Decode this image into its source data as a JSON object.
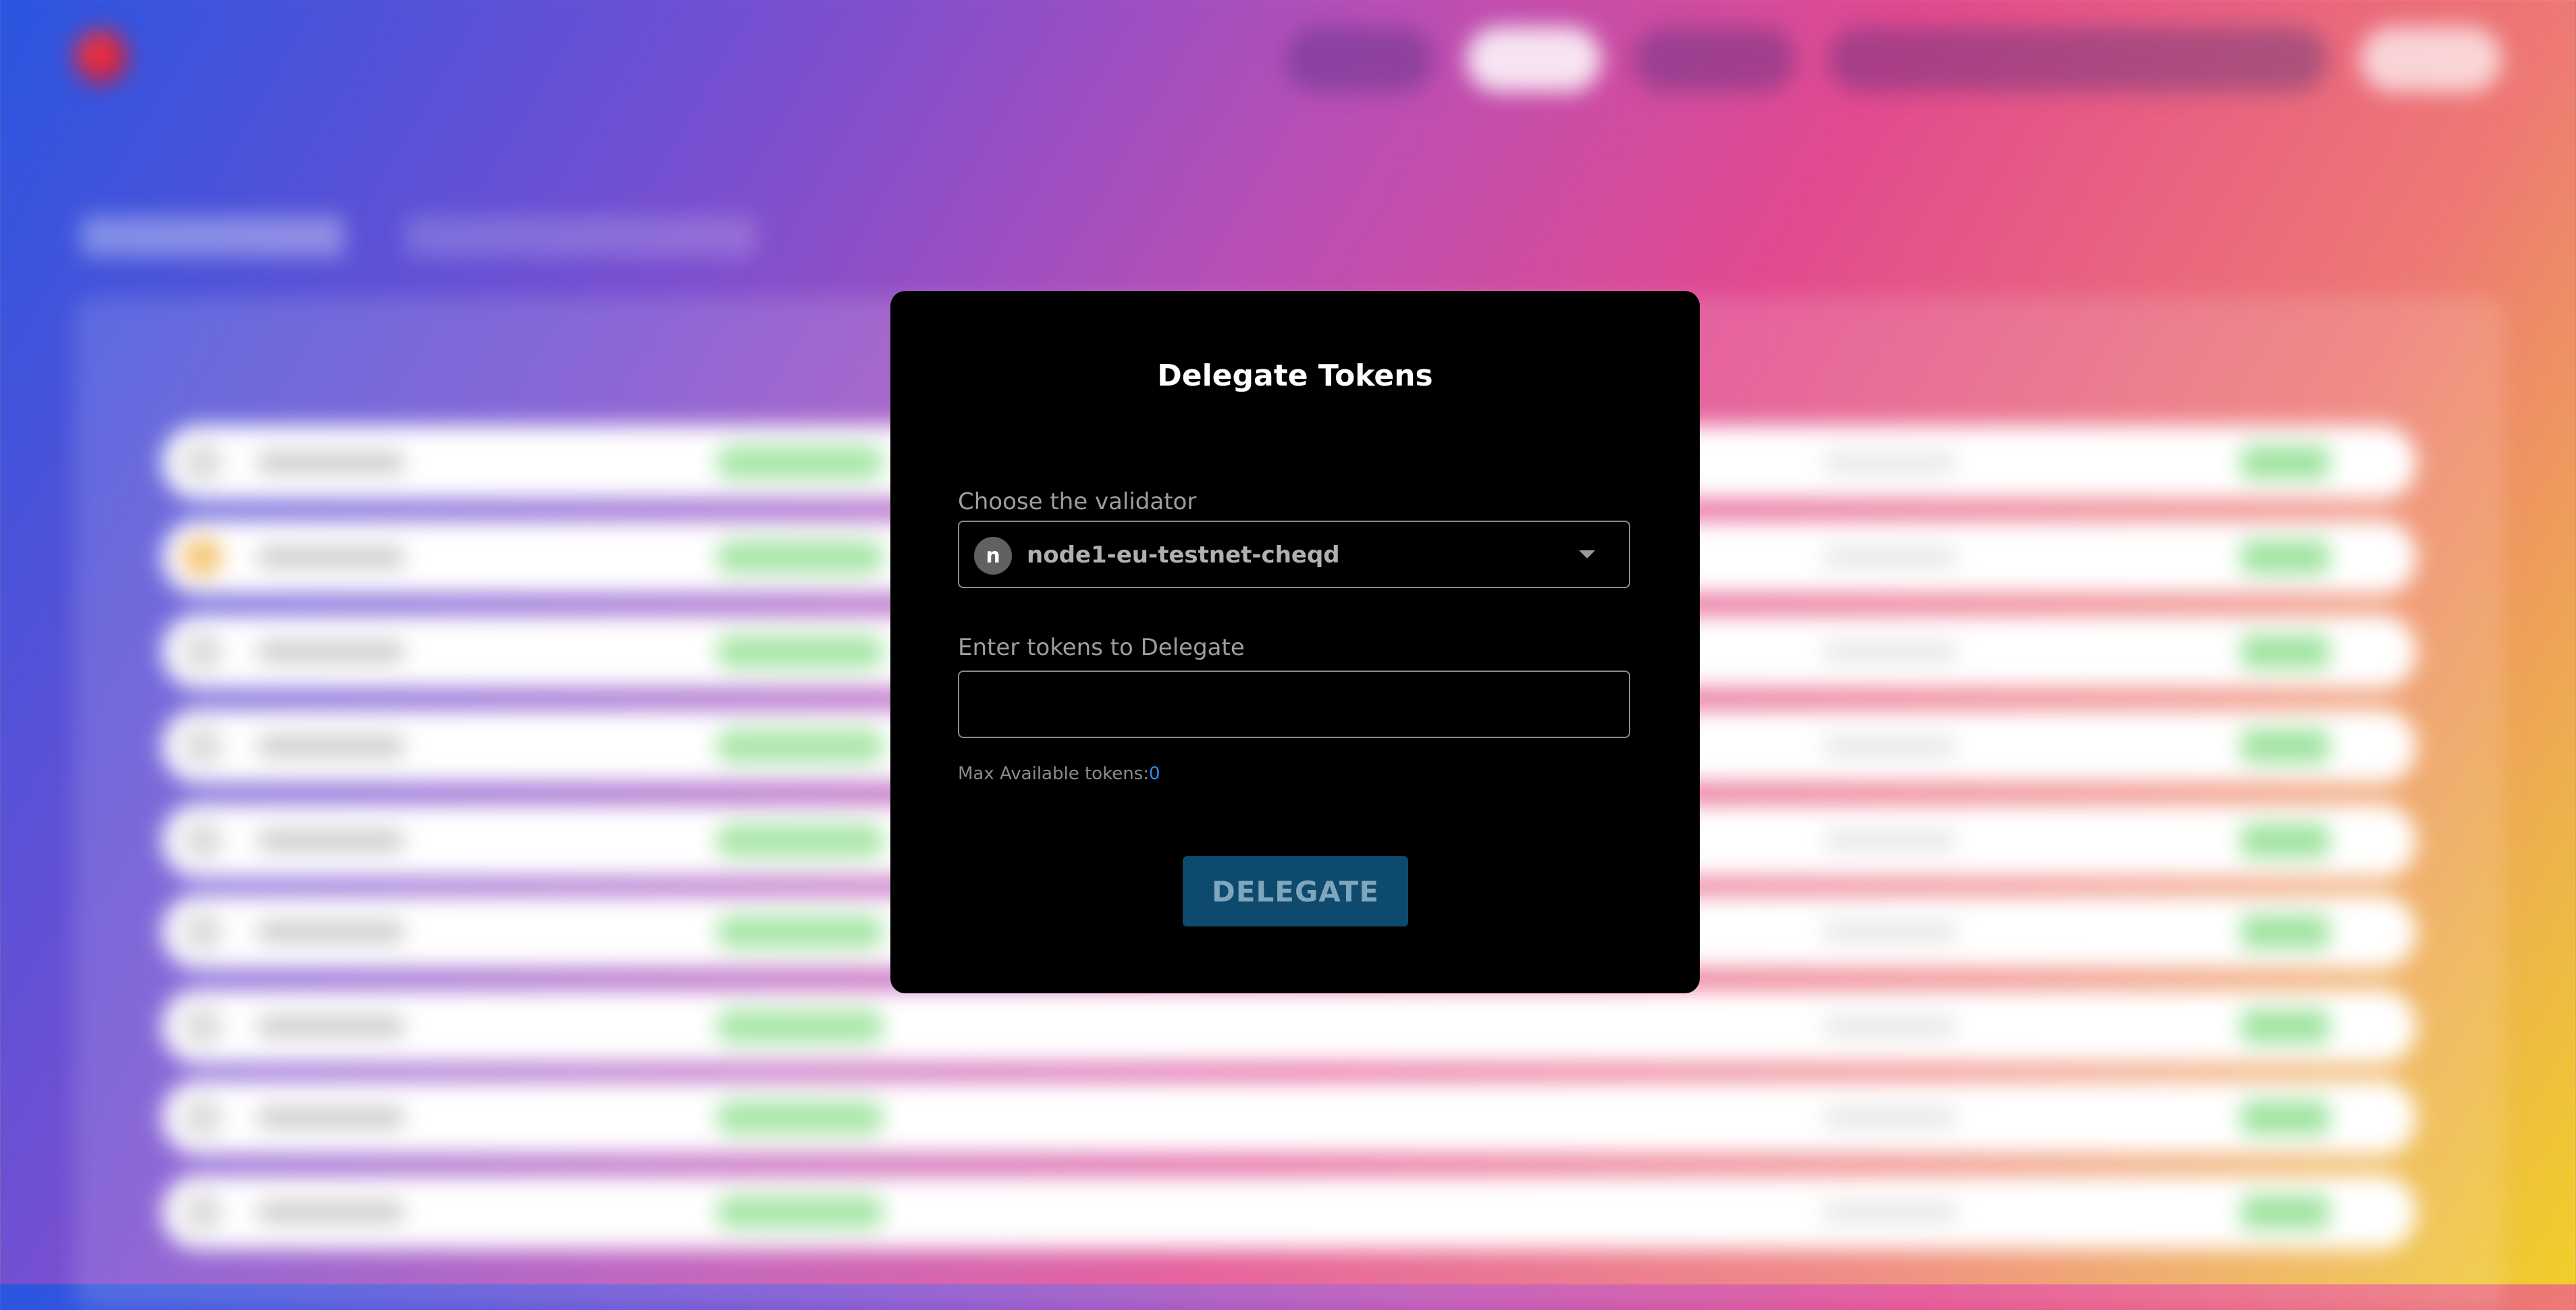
{
  "modal": {
    "title": "Delegate Tokens",
    "validator_label": "Choose the validator",
    "selected_validator": "node1-eu-testnet-cheqd",
    "selected_validator_initial": "n",
    "tokens_label": "Enter tokens to Delegate",
    "tokens_value": "",
    "max_label": "Max Available tokens:",
    "max_value": "0",
    "delegate_button": "DELEGATE"
  },
  "colors": {
    "modal_bg": "#000000",
    "button_bg": "#0e4a6e",
    "max_value": "#2d8cf0"
  }
}
